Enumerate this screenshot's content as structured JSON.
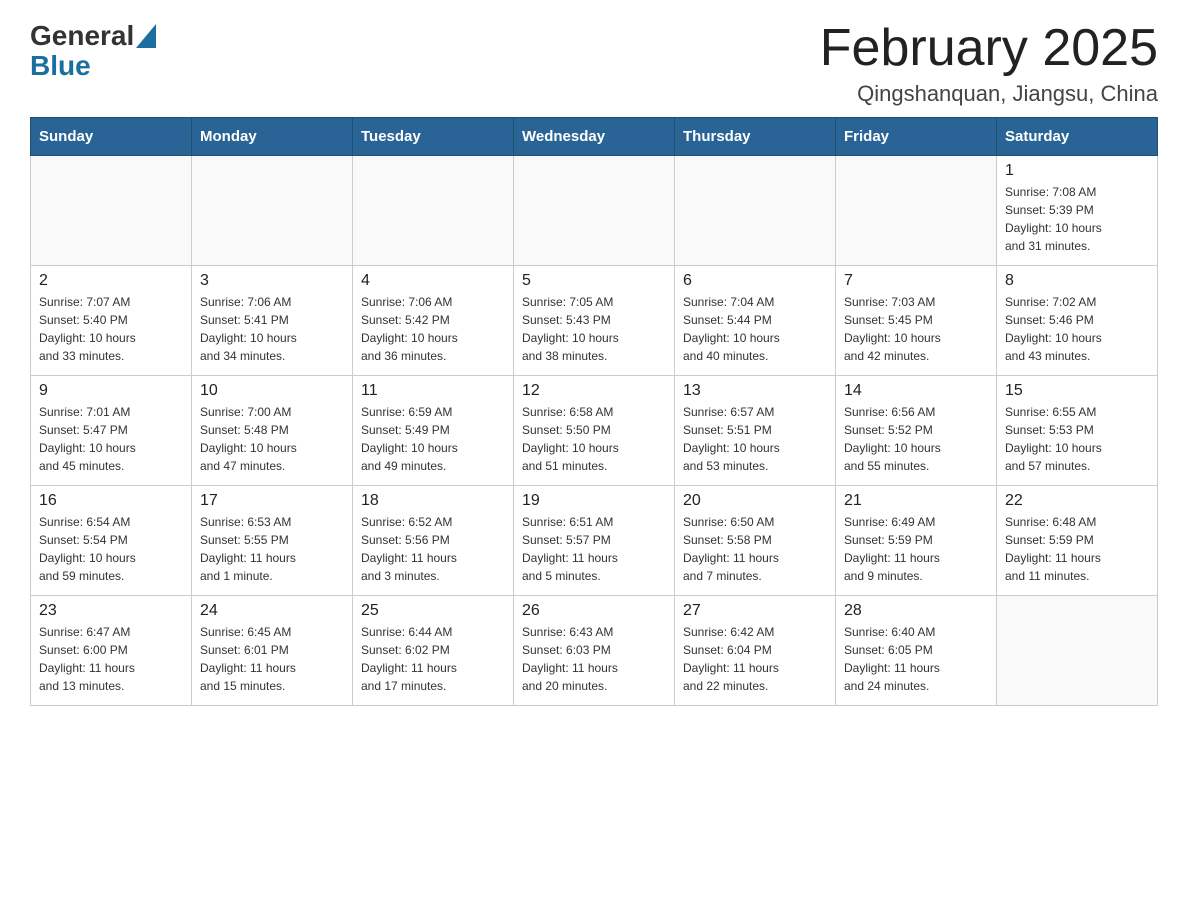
{
  "header": {
    "title": "February 2025",
    "location": "Qingshanquan, Jiangsu, China",
    "logo_general": "General",
    "logo_blue": "Blue"
  },
  "days_of_week": [
    "Sunday",
    "Monday",
    "Tuesday",
    "Wednesday",
    "Thursday",
    "Friday",
    "Saturday"
  ],
  "weeks": [
    [
      {
        "day": "",
        "info": ""
      },
      {
        "day": "",
        "info": ""
      },
      {
        "day": "",
        "info": ""
      },
      {
        "day": "",
        "info": ""
      },
      {
        "day": "",
        "info": ""
      },
      {
        "day": "",
        "info": ""
      },
      {
        "day": "1",
        "info": "Sunrise: 7:08 AM\nSunset: 5:39 PM\nDaylight: 10 hours\nand 31 minutes."
      }
    ],
    [
      {
        "day": "2",
        "info": "Sunrise: 7:07 AM\nSunset: 5:40 PM\nDaylight: 10 hours\nand 33 minutes."
      },
      {
        "day": "3",
        "info": "Sunrise: 7:06 AM\nSunset: 5:41 PM\nDaylight: 10 hours\nand 34 minutes."
      },
      {
        "day": "4",
        "info": "Sunrise: 7:06 AM\nSunset: 5:42 PM\nDaylight: 10 hours\nand 36 minutes."
      },
      {
        "day": "5",
        "info": "Sunrise: 7:05 AM\nSunset: 5:43 PM\nDaylight: 10 hours\nand 38 minutes."
      },
      {
        "day": "6",
        "info": "Sunrise: 7:04 AM\nSunset: 5:44 PM\nDaylight: 10 hours\nand 40 minutes."
      },
      {
        "day": "7",
        "info": "Sunrise: 7:03 AM\nSunset: 5:45 PM\nDaylight: 10 hours\nand 42 minutes."
      },
      {
        "day": "8",
        "info": "Sunrise: 7:02 AM\nSunset: 5:46 PM\nDaylight: 10 hours\nand 43 minutes."
      }
    ],
    [
      {
        "day": "9",
        "info": "Sunrise: 7:01 AM\nSunset: 5:47 PM\nDaylight: 10 hours\nand 45 minutes."
      },
      {
        "day": "10",
        "info": "Sunrise: 7:00 AM\nSunset: 5:48 PM\nDaylight: 10 hours\nand 47 minutes."
      },
      {
        "day": "11",
        "info": "Sunrise: 6:59 AM\nSunset: 5:49 PM\nDaylight: 10 hours\nand 49 minutes."
      },
      {
        "day": "12",
        "info": "Sunrise: 6:58 AM\nSunset: 5:50 PM\nDaylight: 10 hours\nand 51 minutes."
      },
      {
        "day": "13",
        "info": "Sunrise: 6:57 AM\nSunset: 5:51 PM\nDaylight: 10 hours\nand 53 minutes."
      },
      {
        "day": "14",
        "info": "Sunrise: 6:56 AM\nSunset: 5:52 PM\nDaylight: 10 hours\nand 55 minutes."
      },
      {
        "day": "15",
        "info": "Sunrise: 6:55 AM\nSunset: 5:53 PM\nDaylight: 10 hours\nand 57 minutes."
      }
    ],
    [
      {
        "day": "16",
        "info": "Sunrise: 6:54 AM\nSunset: 5:54 PM\nDaylight: 10 hours\nand 59 minutes."
      },
      {
        "day": "17",
        "info": "Sunrise: 6:53 AM\nSunset: 5:55 PM\nDaylight: 11 hours\nand 1 minute."
      },
      {
        "day": "18",
        "info": "Sunrise: 6:52 AM\nSunset: 5:56 PM\nDaylight: 11 hours\nand 3 minutes."
      },
      {
        "day": "19",
        "info": "Sunrise: 6:51 AM\nSunset: 5:57 PM\nDaylight: 11 hours\nand 5 minutes."
      },
      {
        "day": "20",
        "info": "Sunrise: 6:50 AM\nSunset: 5:58 PM\nDaylight: 11 hours\nand 7 minutes."
      },
      {
        "day": "21",
        "info": "Sunrise: 6:49 AM\nSunset: 5:59 PM\nDaylight: 11 hours\nand 9 minutes."
      },
      {
        "day": "22",
        "info": "Sunrise: 6:48 AM\nSunset: 5:59 PM\nDaylight: 11 hours\nand 11 minutes."
      }
    ],
    [
      {
        "day": "23",
        "info": "Sunrise: 6:47 AM\nSunset: 6:00 PM\nDaylight: 11 hours\nand 13 minutes."
      },
      {
        "day": "24",
        "info": "Sunrise: 6:45 AM\nSunset: 6:01 PM\nDaylight: 11 hours\nand 15 minutes."
      },
      {
        "day": "25",
        "info": "Sunrise: 6:44 AM\nSunset: 6:02 PM\nDaylight: 11 hours\nand 17 minutes."
      },
      {
        "day": "26",
        "info": "Sunrise: 6:43 AM\nSunset: 6:03 PM\nDaylight: 11 hours\nand 20 minutes."
      },
      {
        "day": "27",
        "info": "Sunrise: 6:42 AM\nSunset: 6:04 PM\nDaylight: 11 hours\nand 22 minutes."
      },
      {
        "day": "28",
        "info": "Sunrise: 6:40 AM\nSunset: 6:05 PM\nDaylight: 11 hours\nand 24 minutes."
      },
      {
        "day": "",
        "info": ""
      }
    ]
  ]
}
